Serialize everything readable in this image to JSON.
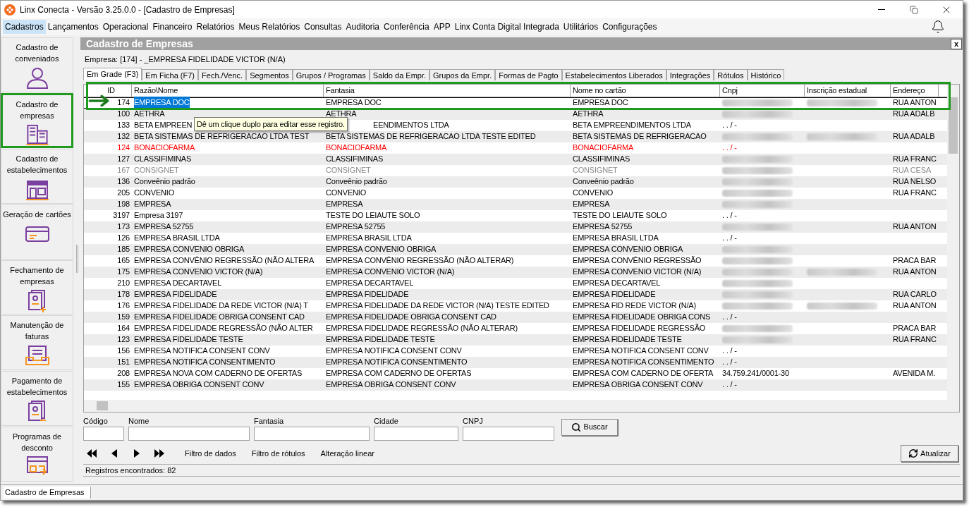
{
  "window": {
    "title": "Linx Conecta - Versão 3.25.0.0 - [Cadastro de Empresas]"
  },
  "menu": [
    {
      "label": "Cadastros",
      "selected": true
    },
    {
      "label": "Lançamentos",
      "selected": false
    },
    {
      "label": "Operacional",
      "selected": false
    },
    {
      "label": "Financeiro",
      "selected": false
    },
    {
      "label": "Relatórios",
      "selected": false
    },
    {
      "label": "Meus Relatórios",
      "selected": false
    },
    {
      "label": "Consultas",
      "selected": false
    },
    {
      "label": "Auditoria",
      "selected": false
    },
    {
      "label": "Conferência",
      "selected": false
    },
    {
      "label": "APP",
      "selected": false
    },
    {
      "label": "Linx Conta Digital Integrada",
      "selected": false
    },
    {
      "label": "Utilitários",
      "selected": false
    },
    {
      "label": "Configurações",
      "selected": false
    }
  ],
  "sidebar": [
    {
      "label": "Cadastro de conveniados",
      "selected": false
    },
    {
      "label": "Cadastro de empresas",
      "selected": true
    },
    {
      "label": "Cadastro de estabelecimentos",
      "selected": false
    },
    {
      "label": "Geração de cartões",
      "selected": false
    },
    {
      "label": "Fechamento de empresas",
      "selected": false
    },
    {
      "label": "Manutenção de faturas",
      "selected": false
    },
    {
      "label": "Pagamento de estabelecimentos",
      "selected": false
    },
    {
      "label": "Programas de desconto",
      "selected": false
    }
  ],
  "panel": {
    "title": "Cadastro de Empresas",
    "close": "x",
    "company": "Empresa: [174] - _EMPRESA FIDELIDADE VICTOR (N/A)"
  },
  "tabs": [
    {
      "label": "Em Grade (F3)",
      "selected": true
    },
    {
      "label": "Em Ficha (F7)",
      "selected": false
    },
    {
      "label": "Fech./Venc.",
      "selected": false
    },
    {
      "label": "Segmentos",
      "selected": false
    },
    {
      "label": "Grupos / Programas",
      "selected": false
    },
    {
      "label": "Saldo da Empr.",
      "selected": false
    },
    {
      "label": "Grupos da Empr.",
      "selected": false
    },
    {
      "label": "Formas de Pagto",
      "selected": false
    },
    {
      "label": "Estabelecimentos Liberados",
      "selected": false
    },
    {
      "label": "Integrações",
      "selected": false
    },
    {
      "label": "Rótulos",
      "selected": false
    },
    {
      "label": "Histórico",
      "selected": false
    }
  ],
  "table": {
    "columns": [
      "ID",
      "Razão\\Nome",
      "Fantasia",
      "Nome no cartão",
      "Cnpj",
      "Inscrição estadual",
      "Endereço"
    ],
    "rows": [
      {
        "id": "174",
        "razao": "EMPRESA DOC",
        "fantasia": "EMPRESA DOC",
        "nome": "EMPRESA DOC",
        "cnpj_redacted": true,
        "ie_redacted": true,
        "endereco": "RUA ANTON",
        "alert": false,
        "disabled": false,
        "selected": true
      },
      {
        "id": "100",
        "razao": "AETHRA",
        "fantasia": "AETHRA",
        "nome": "AETHRA",
        "cnpj_redacted": true,
        "ie_redacted": false,
        "endereco": "RUA ADALB",
        "alert": false,
        "disabled": false,
        "selected": false
      },
      {
        "id": "133",
        "razao": "BETA EMPREEN",
        "tooltip": "Dê um clique duplo para editar esse registro.",
        "fantasia": "EENDIMENTOS LTDA",
        "nome": "BETA EMPREENDIMENTOS LTDA",
        "cnpj": ". . / -",
        "cnpj_redacted": false,
        "ie_redacted": false,
        "alert": false,
        "disabled": false,
        "selected": false
      },
      {
        "id": "132",
        "razao": "BETA SISTEMAS DE REFRIGERACAO LTDA TEST",
        "fantasia": "BETA SISTEMAS DE REFRIGERACAO LTDA TESTE EDITED",
        "nome": "BETA SISTEMAS DE REFRIGERACAO",
        "cnpj_redacted": true,
        "ie_redacted": true,
        "endereco": "RUA ADALB",
        "alert": false,
        "disabled": false,
        "selected": false
      },
      {
        "id": "124",
        "razao": "BONACIOFARMA",
        "fantasia": "BONACIOFARMA",
        "nome": "BONACIOFARMA",
        "cnpj": ". . / -",
        "cnpj_redacted": false,
        "ie_redacted": false,
        "alert": true,
        "disabled": false,
        "selected": false
      },
      {
        "id": "127",
        "razao": "CLASSIFIMINAS",
        "fantasia": "CLASSIFIMINAS",
        "nome": "CLASSIFIMINAS",
        "cnpj_redacted": true,
        "ie_redacted": false,
        "endereco": "RUA FRANC",
        "alert": false,
        "disabled": false,
        "selected": false
      },
      {
        "id": "167",
        "razao": "CONSIGNET",
        "fantasia": "CONSIGNET",
        "nome": "CONSIGNET",
        "cnpj_redacted": true,
        "ie_redacted": false,
        "endereco": "RUA CESA",
        "alert": false,
        "disabled": true,
        "selected": false
      },
      {
        "id": "136",
        "razao": "Conveênio padrão",
        "fantasia": "Conveênio padrão",
        "nome": "Conveênio padrão",
        "cnpj_redacted": true,
        "ie_redacted": false,
        "endereco": "RUA NELSO",
        "alert": false,
        "disabled": false,
        "selected": false
      },
      {
        "id": "205",
        "razao": "CONVENIO",
        "fantasia": "CONVENIO",
        "nome": "CONVENIO",
        "cnpj_redacted": true,
        "ie_redacted": false,
        "endereco": "RUA FRANC",
        "alert": false,
        "disabled": false,
        "selected": false
      },
      {
        "id": "198",
        "razao": "EMPRESA",
        "fantasia": "EMPRESA",
        "nome": "EMPRESA",
        "cnpj_redacted": true,
        "ie_redacted": false,
        "alert": false,
        "disabled": false,
        "selected": false
      },
      {
        "id": "3197",
        "razao": "Empresa 3197",
        "fantasia": "TESTE DO LEIAUTE SOLO",
        "nome": "TESTE DO LEIAUTE SOLO",
        "cnpj": ". . / -",
        "cnpj_redacted": false,
        "ie_redacted": false,
        "alert": false,
        "disabled": false,
        "selected": false
      },
      {
        "id": "173",
        "razao": "EMPRESA 52755",
        "fantasia": "EMPRESA 52755",
        "nome": "EMPRESA 52755",
        "cnpj_redacted": true,
        "ie_redacted": false,
        "endereco": "RUA ANTON",
        "alert": false,
        "disabled": false,
        "selected": false
      },
      {
        "id": "126",
        "razao": "EMPRESA BRASIL LTDA",
        "fantasia": "EMPRESA BRASIL LTDA",
        "nome": "EMPRESA BRASIL LTDA",
        "cnpj": ". . / -",
        "cnpj_redacted": false,
        "ie_redacted": false,
        "alert": false,
        "disabled": false,
        "selected": false
      },
      {
        "id": "185",
        "razao": "EMPRESA CONVENIO OBRIGA",
        "fantasia": "EMPRESA CONVENIO OBRIGA",
        "nome": "EMPRESA CONVENIO OBRIGA",
        "cnpj_redacted": true,
        "ie_redacted": false,
        "alert": false,
        "disabled": false,
        "selected": false
      },
      {
        "id": "165",
        "razao": "EMPRESA CONVÊNIO REGRESSÃO (NÃO ALTERA",
        "fantasia": "EMPRESA CONVÊNIO REGRESSÃO (NÃO ALTERAR)",
        "nome": "EMPRESA CONVÊNIO REGRESSÃO",
        "cnpj_redacted": true,
        "ie_redacted": false,
        "endereco": "PRACA BAR",
        "alert": false,
        "disabled": false,
        "selected": false
      },
      {
        "id": "175",
        "razao": "EMPRESA CONVENIO VICTOR (N/A)",
        "fantasia": "EMPRESA CONVENIO VICTOR (N/A)",
        "nome": "EMPRESA CONVENIO VICTOR (N/A)",
        "cnpj_redacted": true,
        "ie_redacted": true,
        "endereco": "RUA ANTON",
        "alert": false,
        "disabled": false,
        "selected": false
      },
      {
        "id": "210",
        "razao": "EMPRESA DECARTAVEL",
        "fantasia": "EMPRESA DECARTAVEL",
        "nome": "EMPRESA DECARTAVEL",
        "cnpj_redacted": true,
        "ie_redacted": false,
        "alert": false,
        "disabled": false,
        "selected": false
      },
      {
        "id": "178",
        "razao": "EMPRESA FIDELIDADE",
        "fantasia": "EMPRESA FIDELIDADE",
        "nome": "EMPRESA FIDELIDADE",
        "cnpj_redacted": true,
        "ie_redacted": false,
        "endereco": "RUA CARLO",
        "alert": false,
        "disabled": false,
        "selected": false
      },
      {
        "id": "176",
        "razao": "EMPRESA FIDELIDADE DA REDE VICTOR (N/A) T",
        "fantasia": "EMPRESA FIDELIDADE DA REDE VICTOR (N/A) TESTE EDITED",
        "nome": "EMPRESA FID REDE VICTOR (N/A)",
        "cnpj_redacted": true,
        "ie_redacted": true,
        "endereco": "RUA ANTON",
        "alert": false,
        "disabled": false,
        "selected": false
      },
      {
        "id": "159",
        "razao": "EMPRESA FIDELIDADE OBRIGA CONSENT CAD",
        "fantasia": "EMPRESA FIDELIDADE OBRIGA CONSENT CAD",
        "nome": "EMPRESA FIDELIDADE OBRIGA CONS",
        "cnpj": ". . / -",
        "cnpj_redacted": false,
        "ie_redacted": false,
        "alert": false,
        "disabled": false,
        "selected": false
      },
      {
        "id": "164",
        "razao": "EMPRESA FIDELIDADE REGRESSÃO (NÃO ALTER",
        "fantasia": "EMPRESA FIDELIDADE REGRESSÃO (NÃO ALTERAR)",
        "nome": "EMPRESA FIDELIDADE REGRESSÃO",
        "cnpj_redacted": true,
        "ie_redacted": false,
        "endereco": "PRACA BAR",
        "alert": false,
        "disabled": false,
        "selected": false
      },
      {
        "id": "123",
        "razao": "EMPRESA FIDELIDADE TESTE",
        "fantasia": "EMPRESA FIDELIDADE TESTE",
        "nome": "EMPRESA FIDELIDADE TESTE",
        "cnpj_redacted": true,
        "ie_redacted": false,
        "endereco": "RUA FRANC",
        "alert": false,
        "disabled": false,
        "selected": false
      },
      {
        "id": "156",
        "razao": "EMPRESA NOTIFICA CONSENT CONV",
        "fantasia": "EMPRESA NOTIFICA CONSENT CONV",
        "nome": "EMPRESA NOTIFICA CONSENT CONV",
        "cnpj": ". . / -",
        "cnpj_redacted": false,
        "ie_redacted": false,
        "alert": false,
        "disabled": false,
        "selected": false
      },
      {
        "id": "151",
        "razao": "EMPRESA NOTIFICA CONSENTIMENTO",
        "fantasia": "EMPRESA NOTIFICA CONSENTIMENTO",
        "nome": "EMPRESA NOTIFICA CONSENTIMENTO",
        "cnpj": ". . / -",
        "cnpj_redacted": false,
        "ie_redacted": false,
        "alert": false,
        "disabled": false,
        "selected": false
      },
      {
        "id": "208",
        "razao": "EMPRESA NOVA COM CADERNO DE OFERTAS",
        "fantasia": "EMPRESA COM CADERNO DE OFERTAS",
        "nome": "EMPRESA COM CADERNO DE OFERTA",
        "cnpj": "34.759.241/0001-30",
        "cnpj_redacted": false,
        "ie_redacted": false,
        "endereco": "AVENIDA M.",
        "alert": false,
        "disabled": false,
        "selected": false
      },
      {
        "id": "155",
        "razao": "EMPRESA OBRIGA CONSENT CONV",
        "fantasia": "EMPRESA OBRIGA CONSENT CONV",
        "nome": "EMPRESA OBRIGA CONSENT CONV",
        "cnpj": ". . / -",
        "cnpj_redacted": false,
        "ie_redacted": false,
        "alert": false,
        "disabled": false,
        "selected": false
      }
    ]
  },
  "filters": [
    {
      "label": "Código"
    },
    {
      "label": "Nome"
    },
    {
      "label": "Fantasia"
    },
    {
      "label": "Cidade"
    },
    {
      "label": "CNPJ"
    }
  ],
  "search_button": "Buscar",
  "links": [
    "Filtro de dados",
    "Filtro de rótulos",
    "Alteração linear"
  ],
  "refresh_button": "Atualizar",
  "records": "Registros encontrados: 82",
  "status_bar": "Cadastro de Empresas"
}
